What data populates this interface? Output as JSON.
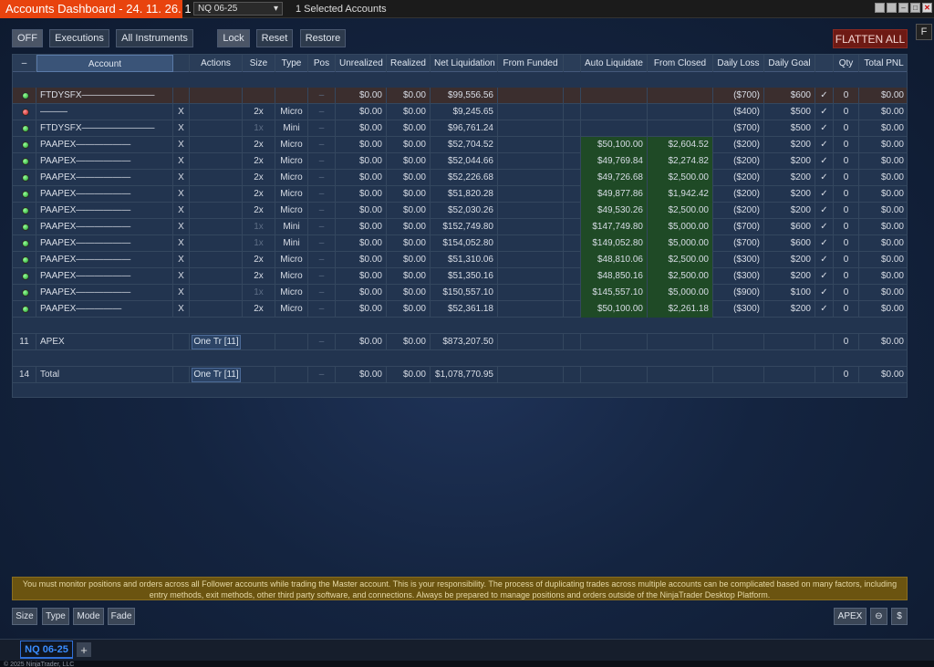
{
  "window": {
    "title": "Accounts Dashboard - 24. 11. 26. 1",
    "instrument": "NQ 06-25",
    "selected_accounts": "1 Selected Accounts",
    "f_label": "F"
  },
  "toolbar": {
    "off": "OFF",
    "executions": "Executions",
    "all_instruments": "All Instruments",
    "lock": "Lock",
    "reset": "Reset",
    "restore": "Restore",
    "flatten_all": "FLATTEN ALL"
  },
  "columns": {
    "collapse": "–",
    "account": "Account",
    "actions": "Actions",
    "size": "Size",
    "type": "Type",
    "pos": "Pos",
    "unrealized": "Unrealized",
    "realized": "Realized",
    "net_liquidation": "Net Liquidation",
    "from_funded": "From Funded",
    "auto_liquidate": "Auto Liquidate",
    "from_closed": "From Closed",
    "daily_loss": "Daily Loss",
    "daily_goal": "Daily Goal",
    "qty": "Qty",
    "total_pnl": "Total PNL"
  },
  "rows": [
    {
      "status": "green",
      "account": "FTDYSFX————————",
      "x": "",
      "size": "",
      "type": "",
      "pos": "–",
      "unrealized": "$0.00",
      "realized": "$0.00",
      "net_liq": "$99,556.56",
      "auto_liq": "",
      "from_closed": "",
      "daily_loss": "($700)",
      "daily_goal": "$600",
      "check": "✓",
      "qty": "0",
      "total_pnl": "$0.00"
    },
    {
      "status": "red",
      "account": "———",
      "x": "X",
      "size": "2x",
      "type": "Micro",
      "pos": "–",
      "unrealized": "$0.00",
      "realized": "$0.00",
      "net_liq": "$9,245.65",
      "auto_liq": "",
      "from_closed": "",
      "daily_loss": "($400)",
      "daily_goal": "$500",
      "check": "✓",
      "qty": "0",
      "total_pnl": "$0.00"
    },
    {
      "status": "green",
      "account": "FTDYSFX————————",
      "x": "X",
      "size": "1x",
      "type": "Mini",
      "pos": "–",
      "unrealized": "$0.00",
      "realized": "$0.00",
      "net_liq": "$96,761.24",
      "auto_liq": "",
      "from_closed": "",
      "daily_loss": "($700)",
      "daily_goal": "$500",
      "check": "✓",
      "qty": "0",
      "total_pnl": "$0.00"
    },
    {
      "status": "green",
      "account": "PAAPEX——————",
      "x": "X",
      "size": "2x",
      "type": "Micro",
      "pos": "–",
      "unrealized": "$0.00",
      "realized": "$0.00",
      "net_liq": "$52,704.52",
      "auto_liq": "$50,100.00",
      "from_closed": "$2,604.52",
      "daily_loss": "($200)",
      "daily_goal": "$200",
      "check": "✓",
      "qty": "0",
      "total_pnl": "$0.00"
    },
    {
      "status": "green",
      "account": "PAAPEX——————",
      "x": "X",
      "size": "2x",
      "type": "Micro",
      "pos": "–",
      "unrealized": "$0.00",
      "realized": "$0.00",
      "net_liq": "$52,044.66",
      "auto_liq": "$49,769.84",
      "from_closed": "$2,274.82",
      "daily_loss": "($200)",
      "daily_goal": "$200",
      "check": "✓",
      "qty": "0",
      "total_pnl": "$0.00"
    },
    {
      "status": "green",
      "account": "PAAPEX——————",
      "x": "X",
      "size": "2x",
      "type": "Micro",
      "pos": "–",
      "unrealized": "$0.00",
      "realized": "$0.00",
      "net_liq": "$52,226.68",
      "auto_liq": "$49,726.68",
      "from_closed": "$2,500.00",
      "daily_loss": "($200)",
      "daily_goal": "$200",
      "check": "✓",
      "qty": "0",
      "total_pnl": "$0.00"
    },
    {
      "status": "green",
      "account": "PAAPEX——————",
      "x": "X",
      "size": "2x",
      "type": "Micro",
      "pos": "–",
      "unrealized": "$0.00",
      "realized": "$0.00",
      "net_liq": "$51,820.28",
      "auto_liq": "$49,877.86",
      "from_closed": "$1,942.42",
      "daily_loss": "($200)",
      "daily_goal": "$200",
      "check": "✓",
      "qty": "0",
      "total_pnl": "$0.00"
    },
    {
      "status": "green",
      "account": "PAAPEX——————",
      "x": "X",
      "size": "2x",
      "type": "Micro",
      "pos": "–",
      "unrealized": "$0.00",
      "realized": "$0.00",
      "net_liq": "$52,030.26",
      "auto_liq": "$49,530.26",
      "from_closed": "$2,500.00",
      "daily_loss": "($200)",
      "daily_goal": "$200",
      "check": "✓",
      "qty": "0",
      "total_pnl": "$0.00"
    },
    {
      "status": "green",
      "account": "PAAPEX——————",
      "x": "X",
      "size": "1x",
      "type": "Mini",
      "pos": "–",
      "unrealized": "$0.00",
      "realized": "$0.00",
      "net_liq": "$152,749.80",
      "auto_liq": "$147,749.80",
      "from_closed": "$5,000.00",
      "daily_loss": "($700)",
      "daily_goal": "$600",
      "check": "✓",
      "qty": "0",
      "total_pnl": "$0.00"
    },
    {
      "status": "green",
      "account": "PAAPEX——————",
      "x": "X",
      "size": "1x",
      "type": "Mini",
      "pos": "–",
      "unrealized": "$0.00",
      "realized": "$0.00",
      "net_liq": "$154,052.80",
      "auto_liq": "$149,052.80",
      "from_closed": "$5,000.00",
      "daily_loss": "($700)",
      "daily_goal": "$600",
      "check": "✓",
      "qty": "0",
      "total_pnl": "$0.00"
    },
    {
      "status": "green",
      "account": "PAAPEX——————",
      "x": "X",
      "size": "2x",
      "type": "Micro",
      "pos": "–",
      "unrealized": "$0.00",
      "realized": "$0.00",
      "net_liq": "$51,310.06",
      "auto_liq": "$48,810.06",
      "from_closed": "$2,500.00",
      "daily_loss": "($300)",
      "daily_goal": "$200",
      "check": "✓",
      "qty": "0",
      "total_pnl": "$0.00"
    },
    {
      "status": "green",
      "account": "PAAPEX——————",
      "x": "X",
      "size": "2x",
      "type": "Micro",
      "pos": "–",
      "unrealized": "$0.00",
      "realized": "$0.00",
      "net_liq": "$51,350.16",
      "auto_liq": "$48,850.16",
      "from_closed": "$2,500.00",
      "daily_loss": "($300)",
      "daily_goal": "$200",
      "check": "✓",
      "qty": "0",
      "total_pnl": "$0.00"
    },
    {
      "status": "green",
      "account": "PAAPEX——————",
      "x": "X",
      "size": "1x",
      "type": "Micro",
      "pos": "–",
      "unrealized": "$0.00",
      "realized": "$0.00",
      "net_liq": "$150,557.10",
      "auto_liq": "$145,557.10",
      "from_closed": "$5,000.00",
      "daily_loss": "($900)",
      "daily_goal": "$100",
      "check": "✓",
      "qty": "0",
      "total_pnl": "$0.00"
    },
    {
      "status": "green",
      "account": "PAAPEX—————",
      "x": "X",
      "size": "2x",
      "type": "Micro",
      "pos": "–",
      "unrealized": "$0.00",
      "realized": "$0.00",
      "net_liq": "$52,361.18",
      "auto_liq": "$50,100.00",
      "from_closed": "$2,261.18",
      "daily_loss": "($300)",
      "daily_goal": "$200",
      "check": "✓",
      "qty": "0",
      "total_pnl": "$0.00"
    }
  ],
  "summary": [
    {
      "count": "11",
      "account": "APEX",
      "action": "One Tr [11]",
      "pos": "–",
      "unrealized": "$0.00",
      "realized": "$0.00",
      "net_liq": "$873,207.50",
      "qty": "0",
      "total_pnl": "$0.00"
    },
    {
      "count": "14",
      "account": "Total",
      "action": "One Tr [11]",
      "pos": "–",
      "unrealized": "$0.00",
      "realized": "$0.00",
      "net_liq": "$1,078,770.95",
      "qty": "0",
      "total_pnl": "$0.00"
    }
  ],
  "warning": "You must monitor positions and orders across all Follower accounts while trading the Master account.  This is your responsibility.  The process of duplicating trades across multiple accounts can be complicated based on many factors, including entry methods, exit methods, other third party software, and connections.  Always be prepared to manage positions and orders outside of the NinjaTrader Desktop Platform.",
  "bottom": {
    "size": "Size",
    "type": "Type",
    "mode": "Mode",
    "fade": "Fade",
    "apex": "APEX",
    "minus": "⊖",
    "dollar": "$"
  },
  "tabs": {
    "active": "NQ 06-25",
    "add": "+"
  },
  "status": {
    "copyright": "© 2025 NinjaTrader, LLC"
  },
  "colors": {
    "accent": "#e8430e",
    "flatten": "#6e1a14",
    "green_cell": "#1f4a26",
    "tab_active": "#3a8dff"
  }
}
